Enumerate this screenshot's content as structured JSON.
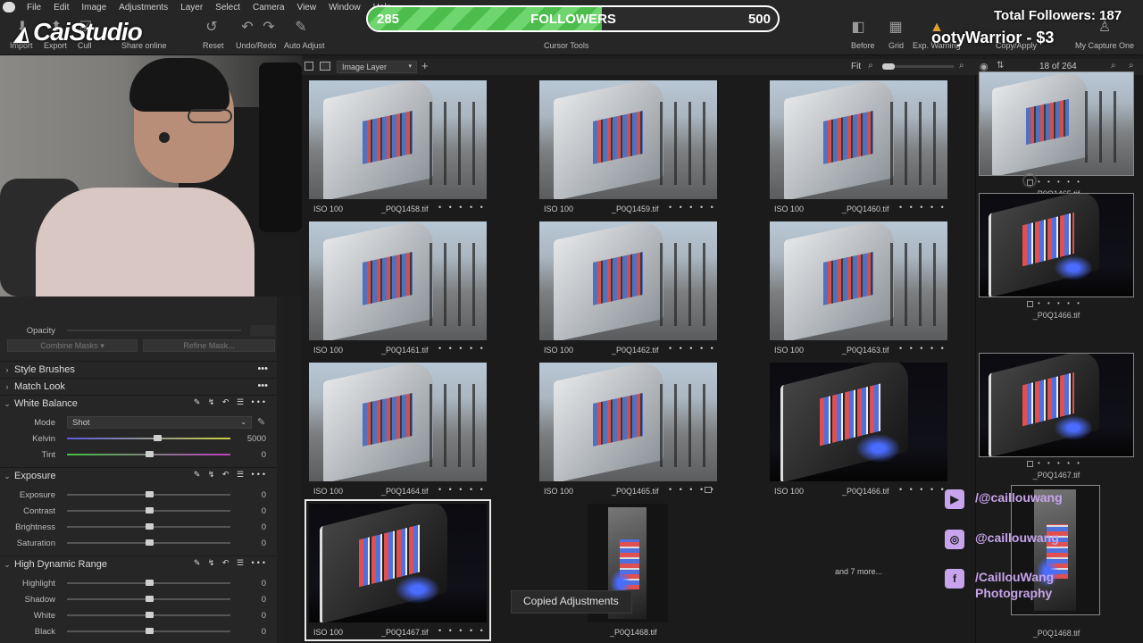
{
  "menu": [
    "File",
    "Edit",
    "Image",
    "Adjustments",
    "Layer",
    "Select",
    "Camera",
    "View",
    "Window",
    "Help"
  ],
  "brand": {
    "logo": "CaiStudio"
  },
  "toolbar": {
    "import": "Import",
    "export": "Export",
    "cull": "Cull",
    "share": "Share online",
    "reset": "Reset",
    "undo_redo": "Undo/Redo",
    "auto_adjust": "Auto Adjust",
    "cursor_tools": "Cursor Tools",
    "before": "Before",
    "grid": "Grid",
    "exp_warning": "Exp. Warning",
    "copy_apply": "Copy/Apply",
    "my_capture_one": "My Capture One"
  },
  "stream": {
    "current": "285",
    "label": "FOLLOWERS",
    "goal": "500",
    "progress": 0.57,
    "total_followers": "Total Followers: 187",
    "donation": "ootyWarrior - $3",
    "youtube": "/@caillouwang",
    "instagram": "@caillouwang",
    "facebook_line1": "/CaillouWang",
    "facebook_line2": "Photography"
  },
  "viewer_bar": {
    "layer_select": "Image Layer",
    "fit": "Fit",
    "counter": "18 of 264"
  },
  "masks": {
    "opacity_label": "Opacity",
    "combine_masks": "Combine Masks",
    "refine_mask": "Refine Mask..."
  },
  "tools": {
    "style_brushes": "Style Brushes",
    "match_look": "Match Look",
    "white_balance": {
      "title": "White Balance",
      "mode_label": "Mode",
      "mode_value": "Shot",
      "kelvin_label": "Kelvin",
      "kelvin_value": "5000",
      "kelvin_level": 0.55,
      "tint_label": "Tint",
      "tint_value": "0",
      "tint_level": 0.5
    },
    "exposure": {
      "title": "Exposure",
      "rows": [
        {
          "label": "Exposure",
          "value": "0",
          "level": 0.5
        },
        {
          "label": "Contrast",
          "value": "0",
          "level": 0.5
        },
        {
          "label": "Brightness",
          "value": "0",
          "level": 0.5
        },
        {
          "label": "Saturation",
          "value": "0",
          "level": 0.5
        }
      ]
    },
    "hdr": {
      "title": "High Dynamic Range",
      "rows": [
        {
          "label": "Highlight",
          "value": "0",
          "level": 0.5
        },
        {
          "label": "Shadow",
          "value": "0",
          "level": 0.5
        },
        {
          "label": "White",
          "value": "0",
          "level": 0.5
        },
        {
          "label": "Black",
          "value": "0",
          "level": 0.5
        }
      ]
    }
  },
  "grid": [
    {
      "iso": "ISO 100",
      "name": "_P0Q1458.tif",
      "tone": "day"
    },
    {
      "iso": "ISO 100",
      "name": "_P0Q1459.tif",
      "tone": "day"
    },
    {
      "iso": "ISO 100",
      "name": "_P0Q1460.tif",
      "tone": "day"
    },
    {
      "iso": "ISO 100",
      "name": "_P0Q1461.tif",
      "tone": "day"
    },
    {
      "iso": "ISO 100",
      "name": "_P0Q1462.tif",
      "tone": "day"
    },
    {
      "iso": "ISO 100",
      "name": "_P0Q1463.tif",
      "tone": "day"
    },
    {
      "iso": "ISO 100",
      "name": "_P0Q1464.tif",
      "tone": "day"
    },
    {
      "iso": "ISO 100",
      "name": "_P0Q1465.tif",
      "tone": "day"
    },
    {
      "iso": "ISO 100",
      "name": "_P0Q1466.tif",
      "tone": "night"
    },
    {
      "iso": "ISO 100",
      "name": "_P0Q1467.tif",
      "tone": "night"
    },
    {
      "iso": "",
      "name": "_P0Q1468.tif",
      "tone": "night-portrait"
    }
  ],
  "dots": "• • • • •",
  "more_label": "and 7 more...",
  "filmstrip": [
    {
      "name": "_P0Q1465.tif",
      "tone": "day"
    },
    {
      "name": "_P0Q1466.tif",
      "tone": "night"
    },
    {
      "name": "_P0Q1467.tif",
      "tone": "night"
    },
    {
      "name": "_P0Q1468.tif",
      "tone": "night-portrait"
    }
  ],
  "toast": "Copied Adjustments",
  "colors": {
    "accent_green": "#4cbc4c",
    "social_purple": "#c7a4ec"
  }
}
